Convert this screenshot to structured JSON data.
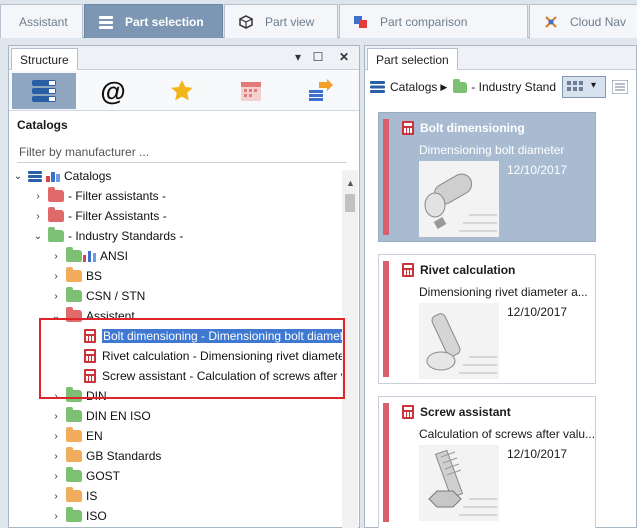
{
  "top_tabs": [
    {
      "label": "Assistant",
      "active": false
    },
    {
      "label": "Part selection",
      "active": true
    },
    {
      "label": "Part view",
      "active": false
    },
    {
      "label": "Part comparison",
      "active": false
    },
    {
      "label": "Cloud Nav",
      "active": false
    }
  ],
  "structure_panel": {
    "tab_label": "Structure",
    "pin_icon": "pin-icon",
    "maximize_icon": "maximize-icon",
    "close_icon": "close-icon",
    "section_label": "Catalogs",
    "filter_placeholder": "Filter by manufacturer ...",
    "tree": {
      "root": "Catalogs",
      "items": [
        {
          "label": "- Filter assistants -",
          "folder": "red",
          "expanded": false
        },
        {
          "label": "- Filter Assistants -",
          "folder": "red",
          "expanded": false
        },
        {
          "label": "- Industry Standards -",
          "folder": "green",
          "expanded": true
        },
        {
          "label": "ANSI",
          "folder": "green",
          "expanded": false
        },
        {
          "label": "BS",
          "folder": "orange",
          "expanded": false
        },
        {
          "label": "CSN / STN",
          "folder": "green",
          "expanded": false
        },
        {
          "label": "Assistent",
          "folder": "red",
          "expanded": true
        },
        {
          "label": "Bolt dimensioning - Dimensioning bolt diamet",
          "selected": true
        },
        {
          "label": "Rivet calculation - Dimensioning rivet diamete"
        },
        {
          "label": "Screw assistant - Calculation of screws after va"
        },
        {
          "label": "DIN",
          "folder": "green",
          "expanded": false
        },
        {
          "label": "DIN EN ISO",
          "folder": "green",
          "expanded": false
        },
        {
          "label": "EN",
          "folder": "orange",
          "expanded": false
        },
        {
          "label": "GB Standards",
          "folder": "orange",
          "expanded": false
        },
        {
          "label": "GOST",
          "folder": "green",
          "expanded": false
        },
        {
          "label": "IS",
          "folder": "orange",
          "expanded": false
        },
        {
          "label": "ISO",
          "folder": "green",
          "expanded": false
        }
      ]
    }
  },
  "selection_panel": {
    "tab_label": "Part selection",
    "breadcrumb": [
      "Catalogs",
      "- Industry Stand"
    ],
    "cards": [
      {
        "title": "Bolt dimensioning",
        "desc": "Dimensioning bolt diameter",
        "date": "12/10/2017",
        "selected": true
      },
      {
        "title": "Rivet calculation",
        "desc": "Dimensioning rivet diameter a...",
        "date": "12/10/2017",
        "selected": false
      },
      {
        "title": "Screw assistant",
        "desc": "Calculation of screws after valu...",
        "date": "12/10/2017",
        "selected": false
      }
    ]
  },
  "colors": {
    "accent": "#7d96b4",
    "selection": "#3e78d0",
    "highlight_box": "#e0242b",
    "calc_icon": "#c9333b"
  }
}
